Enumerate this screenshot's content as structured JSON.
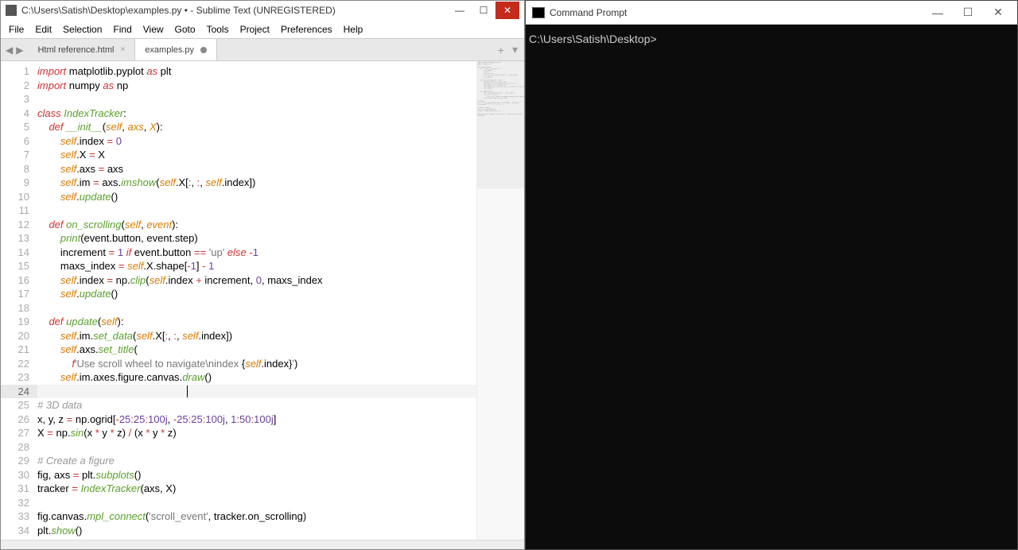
{
  "sublime": {
    "title": "C:\\Users\\Satish\\Desktop\\examples.py • - Sublime Text (UNREGISTERED)",
    "menu": [
      "File",
      "Edit",
      "Selection",
      "Find",
      "View",
      "Goto",
      "Tools",
      "Project",
      "Preferences",
      "Help"
    ],
    "tabs": [
      {
        "label": "Html reference.html",
        "dirty": false
      },
      {
        "label": "examples.py",
        "dirty": true
      }
    ],
    "active_tab": 1,
    "active_line": 24,
    "caret_col": 52
  },
  "code_lines": [
    {
      "n": 1,
      "seg": [
        [
          "kw",
          "import"
        ],
        [
          "",
          ""
        ],
        [
          "name",
          " matplotlib"
        ],
        [
          "punct",
          "."
        ],
        [
          "name",
          "pyplot "
        ],
        [
          "kw",
          "as"
        ],
        [
          "name",
          " plt"
        ]
      ]
    },
    {
      "n": 2,
      "seg": [
        [
          "kw",
          "import"
        ],
        [
          "name",
          " numpy "
        ],
        [
          "kw",
          "as"
        ],
        [
          "name",
          " np"
        ]
      ]
    },
    {
      "n": 3,
      "seg": [
        [
          "",
          ""
        ]
      ]
    },
    {
      "n": 4,
      "seg": [
        [
          "kw",
          "class "
        ],
        [
          "cls",
          "IndexTracker"
        ],
        [
          "punct",
          ":"
        ]
      ]
    },
    {
      "n": 5,
      "seg": [
        [
          "",
          "    "
        ],
        [
          "kw",
          "def "
        ],
        [
          "fnname",
          "__init__"
        ],
        [
          "punct",
          "("
        ],
        [
          "fnarg",
          "self"
        ],
        [
          "punct",
          ", "
        ],
        [
          "fnarg",
          "axs"
        ],
        [
          "punct",
          ", "
        ],
        [
          "fnarg",
          "X"
        ],
        [
          "punct",
          "):"
        ]
      ]
    },
    {
      "n": 6,
      "seg": [
        [
          "",
          "        "
        ],
        [
          "self",
          "self"
        ],
        [
          "punct",
          "."
        ],
        [
          "name",
          "index "
        ],
        [
          "op",
          "="
        ],
        [
          "name",
          " "
        ],
        [
          "num",
          "0"
        ]
      ]
    },
    {
      "n": 7,
      "seg": [
        [
          "",
          "        "
        ],
        [
          "self",
          "self"
        ],
        [
          "punct",
          "."
        ],
        [
          "name",
          "X "
        ],
        [
          "op",
          "="
        ],
        [
          "name",
          " X"
        ]
      ]
    },
    {
      "n": 8,
      "seg": [
        [
          "",
          "        "
        ],
        [
          "self",
          "self"
        ],
        [
          "punct",
          "."
        ],
        [
          "name",
          "axs "
        ],
        [
          "op",
          "="
        ],
        [
          "name",
          " axs"
        ]
      ]
    },
    {
      "n": 9,
      "seg": [
        [
          "",
          "        "
        ],
        [
          "self",
          "self"
        ],
        [
          "punct",
          "."
        ],
        [
          "name",
          "im "
        ],
        [
          "op",
          "="
        ],
        [
          "name",
          " axs"
        ],
        [
          "punct",
          "."
        ],
        [
          "call",
          "imshow"
        ],
        [
          "punct",
          "("
        ],
        [
          "self",
          "self"
        ],
        [
          "punct",
          "."
        ],
        [
          "name",
          "X"
        ],
        [
          "punct",
          "["
        ],
        [
          "op",
          ":"
        ],
        [
          "punct",
          ", "
        ],
        [
          "op",
          ":"
        ],
        [
          "punct",
          ", "
        ],
        [
          "self",
          "self"
        ],
        [
          "punct",
          "."
        ],
        [
          "name",
          "index"
        ],
        [
          "punct",
          "])"
        ]
      ]
    },
    {
      "n": 10,
      "seg": [
        [
          "",
          "        "
        ],
        [
          "self",
          "self"
        ],
        [
          "punct",
          "."
        ],
        [
          "call",
          "update"
        ],
        [
          "punct",
          "()"
        ]
      ]
    },
    {
      "n": 11,
      "seg": [
        [
          "",
          ""
        ]
      ]
    },
    {
      "n": 12,
      "seg": [
        [
          "",
          "    "
        ],
        [
          "kw",
          "def "
        ],
        [
          "fnname",
          "on_scrolling"
        ],
        [
          "punct",
          "("
        ],
        [
          "fnarg",
          "self"
        ],
        [
          "punct",
          ", "
        ],
        [
          "fnarg",
          "event"
        ],
        [
          "punct",
          "):"
        ]
      ]
    },
    {
      "n": 13,
      "seg": [
        [
          "",
          "        "
        ],
        [
          "builtin",
          "print"
        ],
        [
          "punct",
          "("
        ],
        [
          "name",
          "event"
        ],
        [
          "punct",
          "."
        ],
        [
          "name",
          "button"
        ],
        [
          "punct",
          ", "
        ],
        [
          "name",
          "event"
        ],
        [
          "punct",
          "."
        ],
        [
          "name",
          "step"
        ],
        [
          "punct",
          ")"
        ]
      ]
    },
    {
      "n": 14,
      "seg": [
        [
          "",
          "        "
        ],
        [
          "name",
          "increment "
        ],
        [
          "op",
          "="
        ],
        [
          "name",
          " "
        ],
        [
          "num",
          "1"
        ],
        [
          "name",
          " "
        ],
        [
          "kw",
          "if"
        ],
        [
          "name",
          " event"
        ],
        [
          "punct",
          "."
        ],
        [
          "name",
          "button "
        ],
        [
          "op",
          "=="
        ],
        [
          "name",
          " "
        ],
        [
          "str",
          "'up'"
        ],
        [
          "name",
          " "
        ],
        [
          "kw",
          "else"
        ],
        [
          "name",
          " "
        ],
        [
          "op",
          "-"
        ],
        [
          "num",
          "1"
        ]
      ]
    },
    {
      "n": 15,
      "seg": [
        [
          "",
          "        "
        ],
        [
          "name",
          "maxs_index "
        ],
        [
          "op",
          "="
        ],
        [
          "name",
          " "
        ],
        [
          "self",
          "self"
        ],
        [
          "punct",
          "."
        ],
        [
          "name",
          "X"
        ],
        [
          "punct",
          "."
        ],
        [
          "name",
          "shape"
        ],
        [
          "punct",
          "["
        ],
        [
          "op",
          "-"
        ],
        [
          "num",
          "1"
        ],
        [
          "punct",
          "] "
        ],
        [
          "op",
          "-"
        ],
        [
          "name",
          " "
        ],
        [
          "num",
          "1"
        ]
      ]
    },
    {
      "n": 16,
      "seg": [
        [
          "",
          "        "
        ],
        [
          "self",
          "self"
        ],
        [
          "punct",
          "."
        ],
        [
          "name",
          "index "
        ],
        [
          "op",
          "="
        ],
        [
          "name",
          " np"
        ],
        [
          "punct",
          "."
        ],
        [
          "call",
          "clip"
        ],
        [
          "punct",
          "("
        ],
        [
          "self",
          "self"
        ],
        [
          "punct",
          "."
        ],
        [
          "name",
          "index "
        ],
        [
          "op",
          "+"
        ],
        [
          "name",
          " increment"
        ],
        [
          "punct",
          ", "
        ],
        [
          "num",
          "0"
        ],
        [
          "punct",
          ", "
        ],
        [
          "name",
          "maxs_index"
        ]
      ]
    },
    {
      "n": 17,
      "seg": [
        [
          "",
          "        "
        ],
        [
          "self",
          "self"
        ],
        [
          "punct",
          "."
        ],
        [
          "call",
          "update"
        ],
        [
          "punct",
          "()"
        ]
      ]
    },
    {
      "n": 18,
      "seg": [
        [
          "",
          ""
        ]
      ]
    },
    {
      "n": 19,
      "seg": [
        [
          "",
          "    "
        ],
        [
          "kw",
          "def "
        ],
        [
          "fnname",
          "update"
        ],
        [
          "punct",
          "("
        ],
        [
          "fnarg",
          "self"
        ],
        [
          "punct",
          "):"
        ]
      ]
    },
    {
      "n": 20,
      "seg": [
        [
          "",
          "        "
        ],
        [
          "self",
          "self"
        ],
        [
          "punct",
          "."
        ],
        [
          "name",
          "im"
        ],
        [
          "punct",
          "."
        ],
        [
          "call",
          "set_data"
        ],
        [
          "punct",
          "("
        ],
        [
          "self",
          "self"
        ],
        [
          "punct",
          "."
        ],
        [
          "name",
          "X"
        ],
        [
          "punct",
          "["
        ],
        [
          "op",
          ":"
        ],
        [
          "punct",
          ", "
        ],
        [
          "op",
          ":"
        ],
        [
          "punct",
          ", "
        ],
        [
          "self",
          "self"
        ],
        [
          "punct",
          "."
        ],
        [
          "name",
          "index"
        ],
        [
          "punct",
          "])"
        ]
      ]
    },
    {
      "n": 21,
      "seg": [
        [
          "",
          "        "
        ],
        [
          "self",
          "self"
        ],
        [
          "punct",
          "."
        ],
        [
          "name",
          "axs"
        ],
        [
          "punct",
          "."
        ],
        [
          "call",
          "set_title"
        ],
        [
          "punct",
          "("
        ]
      ]
    },
    {
      "n": 22,
      "seg": [
        [
          "",
          "            "
        ],
        [
          "fstr-kw",
          "f"
        ],
        [
          "str",
          "'Use scroll wheel to navigate\\nindex "
        ],
        [
          "punct",
          "{"
        ],
        [
          "self",
          "self"
        ],
        [
          "punct",
          "."
        ],
        [
          "name",
          "index"
        ],
        [
          "punct",
          "}"
        ],
        [
          "str",
          "'"
        ],
        [
          "punct",
          ")"
        ]
      ]
    },
    {
      "n": 23,
      "seg": [
        [
          "",
          "        "
        ],
        [
          "self",
          "self"
        ],
        [
          "punct",
          "."
        ],
        [
          "name",
          "im"
        ],
        [
          "punct",
          "."
        ],
        [
          "name",
          "axes"
        ],
        [
          "punct",
          "."
        ],
        [
          "name",
          "figure"
        ],
        [
          "punct",
          "."
        ],
        [
          "name",
          "canvas"
        ],
        [
          "punct",
          "."
        ],
        [
          "call",
          "draw"
        ],
        [
          "punct",
          "()"
        ]
      ]
    },
    {
      "n": 24,
      "seg": [
        [
          "",
          ""
        ]
      ]
    },
    {
      "n": 25,
      "seg": [
        [
          "comment",
          "# 3D data"
        ]
      ]
    },
    {
      "n": 26,
      "seg": [
        [
          "name",
          "x"
        ],
        [
          "punct",
          ", "
        ],
        [
          "name",
          "y"
        ],
        [
          "punct",
          ", "
        ],
        [
          "name",
          "z "
        ],
        [
          "op",
          "="
        ],
        [
          "name",
          " np"
        ],
        [
          "punct",
          "."
        ],
        [
          "name",
          "ogrid"
        ],
        [
          "punct",
          "["
        ],
        [
          "op",
          "-"
        ],
        [
          "num",
          "25"
        ],
        [
          "op",
          ":"
        ],
        [
          "num",
          "25"
        ],
        [
          "op",
          ":"
        ],
        [
          "num",
          "100j"
        ],
        [
          "punct",
          ", "
        ],
        [
          "op",
          "-"
        ],
        [
          "num",
          "25"
        ],
        [
          "op",
          ":"
        ],
        [
          "num",
          "25"
        ],
        [
          "op",
          ":"
        ],
        [
          "num",
          "100j"
        ],
        [
          "punct",
          ", "
        ],
        [
          "num",
          "1"
        ],
        [
          "op",
          ":"
        ],
        [
          "num",
          "50"
        ],
        [
          "op",
          ":"
        ],
        [
          "num",
          "100j"
        ],
        [
          "punct",
          "]"
        ]
      ]
    },
    {
      "n": 27,
      "seg": [
        [
          "name",
          "X "
        ],
        [
          "op",
          "="
        ],
        [
          "name",
          " np"
        ],
        [
          "punct",
          "."
        ],
        [
          "call",
          "sin"
        ],
        [
          "punct",
          "("
        ],
        [
          "name",
          "x "
        ],
        [
          "op",
          "*"
        ],
        [
          "name",
          " y "
        ],
        [
          "op",
          "*"
        ],
        [
          "name",
          " z"
        ],
        [
          "punct",
          ") "
        ],
        [
          "op",
          "/"
        ],
        [
          "punct",
          " ("
        ],
        [
          "name",
          "x "
        ],
        [
          "op",
          "*"
        ],
        [
          "name",
          " y "
        ],
        [
          "op",
          "*"
        ],
        [
          "name",
          " z"
        ],
        [
          "punct",
          ")"
        ]
      ]
    },
    {
      "n": 28,
      "seg": [
        [
          "",
          ""
        ]
      ]
    },
    {
      "n": 29,
      "seg": [
        [
          "comment",
          "# Create a figure"
        ]
      ]
    },
    {
      "n": 30,
      "seg": [
        [
          "name",
          "fig"
        ],
        [
          "punct",
          ", "
        ],
        [
          "name",
          "axs "
        ],
        [
          "op",
          "="
        ],
        [
          "name",
          " plt"
        ],
        [
          "punct",
          "."
        ],
        [
          "call",
          "subplots"
        ],
        [
          "punct",
          "()"
        ]
      ]
    },
    {
      "n": 31,
      "seg": [
        [
          "name",
          "tracker "
        ],
        [
          "op",
          "="
        ],
        [
          "name",
          " "
        ],
        [
          "cls",
          "IndexTracker"
        ],
        [
          "punct",
          "("
        ],
        [
          "name",
          "axs"
        ],
        [
          "punct",
          ", "
        ],
        [
          "name",
          "X"
        ],
        [
          "punct",
          ")"
        ]
      ]
    },
    {
      "n": 32,
      "seg": [
        [
          "",
          ""
        ]
      ]
    },
    {
      "n": 33,
      "seg": [
        [
          "name",
          "fig"
        ],
        [
          "punct",
          "."
        ],
        [
          "name",
          "canvas"
        ],
        [
          "punct",
          "."
        ],
        [
          "call",
          "mpl_connect"
        ],
        [
          "punct",
          "("
        ],
        [
          "str",
          "'scroll_event'"
        ],
        [
          "punct",
          ", "
        ],
        [
          "name",
          "tracker"
        ],
        [
          "punct",
          "."
        ],
        [
          "name",
          "on_scrolling"
        ],
        [
          "punct",
          ")"
        ]
      ]
    },
    {
      "n": 34,
      "seg": [
        [
          "name",
          "plt"
        ],
        [
          "punct",
          "."
        ],
        [
          "call",
          "show"
        ],
        [
          "punct",
          "()"
        ]
      ]
    }
  ],
  "cmd": {
    "title": "Command Prompt",
    "prompt": "C:\\Users\\Satish\\Desktop>"
  }
}
